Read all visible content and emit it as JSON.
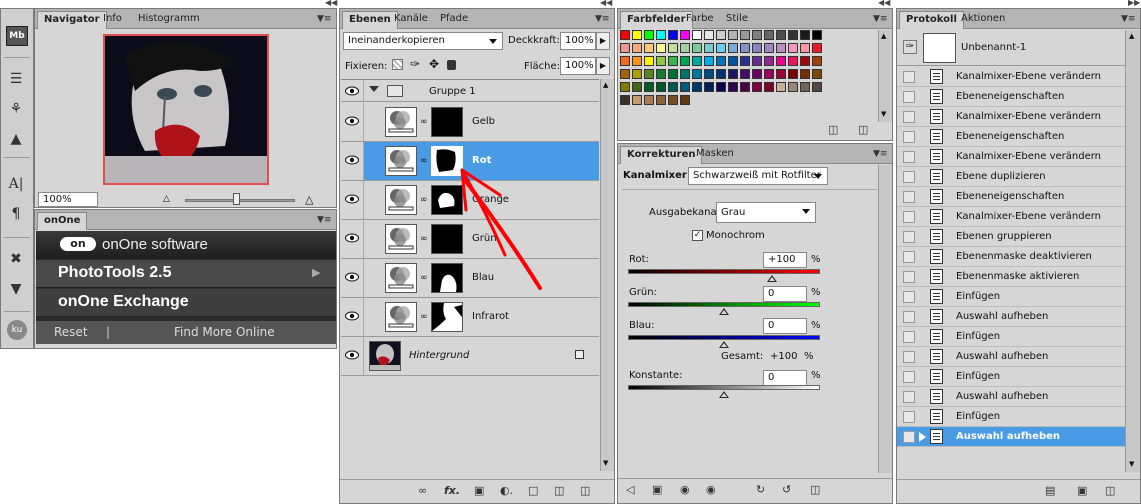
{
  "tools": {
    "mb_label": "Mb",
    "ku_label": "ku"
  },
  "navigator": {
    "tabs": [
      "Navigator",
      "Info",
      "Histogramm"
    ],
    "zoom": "100%"
  },
  "onone": {
    "tab": "onOne",
    "logo": "onOne software",
    "items": [
      "PhotoTools 2.5",
      "onOne Exchange"
    ],
    "reset": "Reset",
    "separator": "|",
    "find_more": "Find More Online"
  },
  "layers": {
    "tabs": [
      "Ebenen",
      "Kanäle",
      "Pfade"
    ],
    "blend_mode": "Ineinanderkopieren",
    "opacity_label": "Deckkraft:",
    "opacity": "100%",
    "lock_label": "Fixieren:",
    "fill_label": "Fläche:",
    "fill": "100%",
    "group": "Gruppe 1",
    "items": [
      "Gelb",
      "Rot",
      "Orange",
      "Grün",
      "Blau",
      "Infrarot"
    ],
    "selected_index": 1,
    "background": "Hintergrund"
  },
  "swatches": {
    "tabs": [
      "Farbfelder",
      "Farbe",
      "Stile"
    ],
    "colors": [
      "#ff0000",
      "#ffff00",
      "#00ff00",
      "#00ffff",
      "#0000ff",
      "#ff00ff",
      "#ffffff",
      "#e6e6e6",
      "#cccccc",
      "#b3b3b3",
      "#999999",
      "#808080",
      "#666666",
      "#4d4d4d",
      "#333333",
      "#1a1a1a",
      "#000000",
      "#f2968d",
      "#f5a87b",
      "#fac878",
      "#fff699",
      "#c4df9b",
      "#a3d39c",
      "#82ca9c",
      "#7accc8",
      "#6dcff6",
      "#7da7d9",
      "#8393ca",
      "#8781bd",
      "#a186be",
      "#bd8cbf",
      "#f49ac1",
      "#f6989d",
      "#ed1c24",
      "#f26522",
      "#f7941d",
      "#fff200",
      "#8dc63f",
      "#39b54a",
      "#00a651",
      "#00a99d",
      "#00aeef",
      "#0072bc",
      "#0054a6",
      "#2e3192",
      "#662d91",
      "#92278f",
      "#ec008c",
      "#ed145b",
      "#9e0b0f",
      "#a0410d",
      "#a36209",
      "#aba000",
      "#598527",
      "#197b30",
      "#007236",
      "#00746b",
      "#0076a3",
      "#004a80",
      "#003471",
      "#1b1464",
      "#440e62",
      "#630460",
      "#9e005d",
      "#9e0039",
      "#790000",
      "#7b2e00",
      "#7d4900",
      "#827b00",
      "#406618",
      "#005e20",
      "#005826",
      "#005952",
      "#005b7f",
      "#003663",
      "#002157",
      "#0d004c",
      "#32004b",
      "#4b0049",
      "#7b0046",
      "#7a0026",
      "#c7b299",
      "#998675",
      "#736357",
      "#534741",
      "#37302d",
      "#c69c6d",
      "#a67c52",
      "#8c6239",
      "#754c24",
      "#603913"
    ]
  },
  "adjustments": {
    "tabs": [
      "Korrekturen",
      "Masken"
    ],
    "title": "Kanalmixer",
    "preset": "Schwarzweiß mit Rotfilter",
    "output_label": "Ausgabekanal:",
    "output": "Grau",
    "mono_label": "Monochrom",
    "red_label": "Rot:",
    "red": "+100",
    "green_label": "Grün:",
    "green": "0",
    "blue_label": "Blau:",
    "blue": "0",
    "pct": "%",
    "total_label": "Gesamt:",
    "total": "+100",
    "constant_label": "Konstante:",
    "constant": "0",
    "levels": {
      "red": 0.75,
      "green": 0.5,
      "blue": 0.5,
      "constant": 0.5
    }
  },
  "history": {
    "tabs": [
      "Protokoll",
      "Aktionen"
    ],
    "snapshot": "Unbenannt-1",
    "items": [
      "Kanalmixer-Ebene verändern",
      "Ebeneneigenschaften",
      "Kanalmixer-Ebene verändern",
      "Ebeneneigenschaften",
      "Kanalmixer-Ebene verändern",
      "Ebene duplizieren",
      "Ebeneneigenschaften",
      "Kanalmixer-Ebene verändern",
      "Ebenen gruppieren",
      "Ebenenmaske deaktivieren",
      "Ebenenmaske aktivieren",
      "Einfügen",
      "Auswahl aufheben",
      "Einfügen",
      "Auswahl aufheben",
      "Einfügen",
      "Auswahl aufheben",
      "Einfügen",
      "Auswahl aufheben"
    ]
  }
}
